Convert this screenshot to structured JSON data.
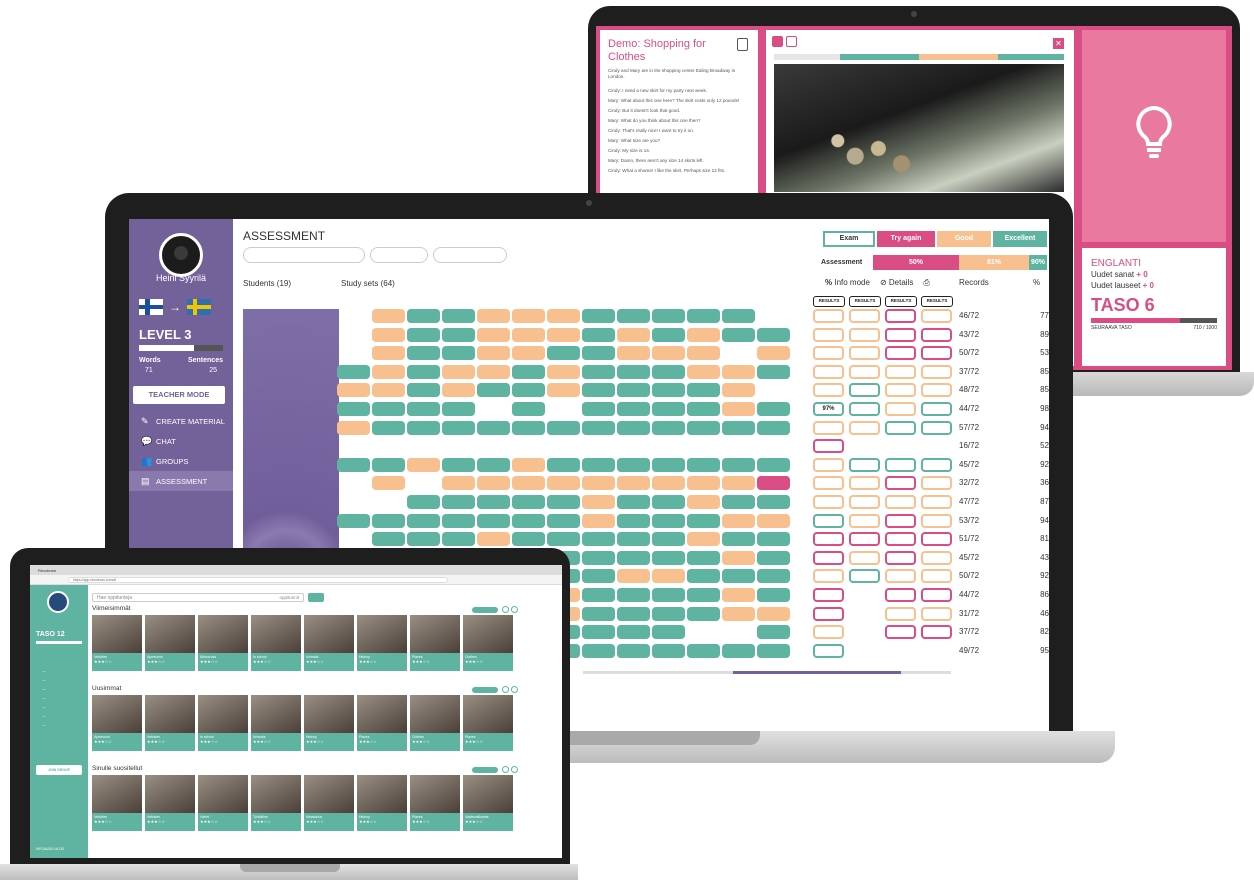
{
  "colors": {
    "pink": "#d94d84",
    "teal": "#5eb3a1",
    "orange": "#f7c08e",
    "purple": "#736199"
  },
  "lesson": {
    "title": "Demo: Shopping for Clothes",
    "intro": "Cindy and Mary are in the shopping center Ealing Broadway in London.",
    "lines": [
      "Cindy: I need a new skirt for my party next week.",
      "Mary: What about this one here? The skirt costs only 12 pounds!",
      "Cindy: But it doesn't look that good.",
      "Mary: What do you think about this one then?",
      "Cindy: That's really nice! I want to try it on.",
      "Mary: What size are you?",
      "Cindy: My size is 14.",
      "Mary: Damn, there aren't any size 14 skirts left.",
      "Cindy: What a shame! I like the skirt. Perhaps size 12 fits."
    ],
    "tip_icon": "lightbulb-icon",
    "level_card": {
      "language": "ENGLANTI",
      "new_words_label": "Uudet sanat",
      "new_words_value": "+ 0",
      "new_sentences_label": "Uudet lauseet",
      "new_sentences_value": "+ 0",
      "level": "TASO 6",
      "next_label": "SEURAAVA TASO",
      "next_value": "710 / 1000",
      "progress": 0.71
    }
  },
  "sidebar": {
    "user_name": "Heini Syyrilä",
    "arrow": "→",
    "level": "LEVEL 3",
    "words_label": "Words",
    "sentences_label": "Sentences",
    "words": "71",
    "sentences": "25",
    "teacher_mode": "TEACHER MODE",
    "items": [
      {
        "label": "CREATE MATERIAL",
        "icon": "pencil-icon"
      },
      {
        "label": "CHAT",
        "icon": "chat-icon"
      },
      {
        "label": "GROUPS",
        "icon": "users-icon"
      },
      {
        "label": "ASSESSMENT",
        "icon": "assessment-icon"
      }
    ]
  },
  "assessment": {
    "title": "ASSESSMENT",
    "students_label": "Students (19)",
    "study_sets_label": "Study sets (64)",
    "legend": {
      "exam": "Exam",
      "try_again": "Try again",
      "good": "Good",
      "excellent": "Excellent"
    },
    "assessment_label": "Assessment",
    "thresholds": [
      "50%",
      "81%",
      "90%"
    ],
    "info_mode": "Info mode",
    "details": "Details",
    "records_label": "Records",
    "pct_label": "%",
    "results_label": "RESULTS",
    "cell_value": "97%",
    "rows": [
      {
        "records": "46/72",
        "pct": "77"
      },
      {
        "records": "43/72",
        "pct": "89"
      },
      {
        "records": "50/72",
        "pct": "53"
      },
      {
        "records": "37/72",
        "pct": "85"
      },
      {
        "records": "48/72",
        "pct": "85"
      },
      {
        "records": "44/72",
        "pct": "98"
      },
      {
        "records": "57/72",
        "pct": "94"
      },
      {
        "records": "16/72",
        "pct": "52"
      },
      {
        "records": "45/72",
        "pct": "92"
      },
      {
        "records": "32/72",
        "pct": "36"
      },
      {
        "records": "47/72",
        "pct": "87"
      },
      {
        "records": "53/72",
        "pct": "94"
      },
      {
        "records": "51/72",
        "pct": "81"
      },
      {
        "records": "45/72",
        "pct": "43"
      },
      {
        "records": "50/72",
        "pct": "92"
      },
      {
        "records": "44/72",
        "pct": "86"
      },
      {
        "records": "31/72",
        "pct": "46"
      },
      {
        "records": "37/72",
        "pct": "82"
      },
      {
        "records": "49/72",
        "pct": "95"
      }
    ]
  },
  "browser": {
    "tab_title": "Revolearn",
    "url": "https://app.revolearn.com/#/",
    "search_placeholder": "Hae oppitunteja",
    "search_select": "oppitunnit",
    "taso": "TASO 12",
    "sections": [
      {
        "title": "Viimeisimmät",
        "cards": [
          "Vehicles",
          "Ajoneuvot",
          "Motocross",
          "In school",
          "Animals",
          "History",
          "Places",
          "Clothes"
        ]
      },
      {
        "title": "Uusimmat",
        "cards": [
          "Ajoneuvot",
          "Vehicles",
          "In school",
          "Animals",
          "History",
          "Places",
          "Clothes",
          "Places"
        ]
      },
      {
        "title": "Sinulle suositellut",
        "cards": [
          "Vehicles",
          "Vehicles",
          "Varlet",
          "Työväline",
          "Maatalous",
          "History",
          "Places",
          "Vaatevalikoima"
        ]
      }
    ],
    "join_group": "JOIN GROUP",
    "bottom_link": "KIRJAUDU ULOS",
    "stars": "★★★☆☆"
  }
}
